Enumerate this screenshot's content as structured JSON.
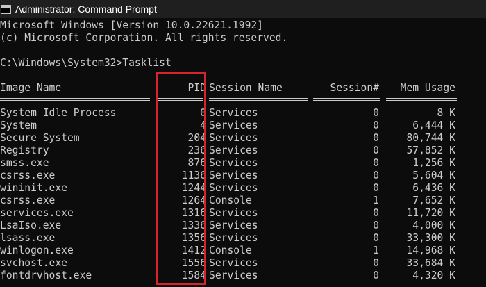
{
  "window": {
    "title": "Administrator: Command Prompt",
    "icon": "cmd-icon",
    "highlight_color": "#d6232e"
  },
  "console": {
    "banner_line1": "Microsoft Windows [Version 10.0.22621.1992]",
    "banner_line2": "(c) Microsoft Corporation. All rights reserved.",
    "prompt_line": "C:\\Windows\\System32>Tasklist",
    "headers": {
      "image_name": "Image Name",
      "pid": "PID",
      "session_name": "Session Name",
      "session_num": "Session#",
      "mem_usage": "Mem Usage"
    },
    "rows": [
      {
        "name": "System Idle Process",
        "pid": "0",
        "session": "Services",
        "num": "0",
        "mem": "8 K"
      },
      {
        "name": "System",
        "pid": "4",
        "session": "Services",
        "num": "0",
        "mem": "6,444 K"
      },
      {
        "name": "Secure System",
        "pid": "204",
        "session": "Services",
        "num": "0",
        "mem": "80,744 K"
      },
      {
        "name": "Registry",
        "pid": "236",
        "session": "Services",
        "num": "0",
        "mem": "57,852 K"
      },
      {
        "name": "smss.exe",
        "pid": "876",
        "session": "Services",
        "num": "0",
        "mem": "1,256 K"
      },
      {
        "name": "csrss.exe",
        "pid": "1136",
        "session": "Services",
        "num": "0",
        "mem": "5,604 K"
      },
      {
        "name": "wininit.exe",
        "pid": "1244",
        "session": "Services",
        "num": "0",
        "mem": "6,436 K"
      },
      {
        "name": "csrss.exe",
        "pid": "1264",
        "session": "Console",
        "num": "1",
        "mem": "7,652 K"
      },
      {
        "name": "services.exe",
        "pid": "1316",
        "session": "Services",
        "num": "0",
        "mem": "11,720 K"
      },
      {
        "name": "LsaIso.exe",
        "pid": "1336",
        "session": "Services",
        "num": "0",
        "mem": "4,000 K"
      },
      {
        "name": "lsass.exe",
        "pid": "1356",
        "session": "Services",
        "num": "0",
        "mem": "33,300 K"
      },
      {
        "name": "winlogon.exe",
        "pid": "1412",
        "session": "Console",
        "num": "1",
        "mem": "14,968 K"
      },
      {
        "name": "svchost.exe",
        "pid": "1556",
        "session": "Services",
        "num": "0",
        "mem": "33,684 K"
      },
      {
        "name": "fontdrvhost.exe",
        "pid": "1584",
        "session": "Services",
        "num": "0",
        "mem": "4,320 K"
      }
    ]
  }
}
